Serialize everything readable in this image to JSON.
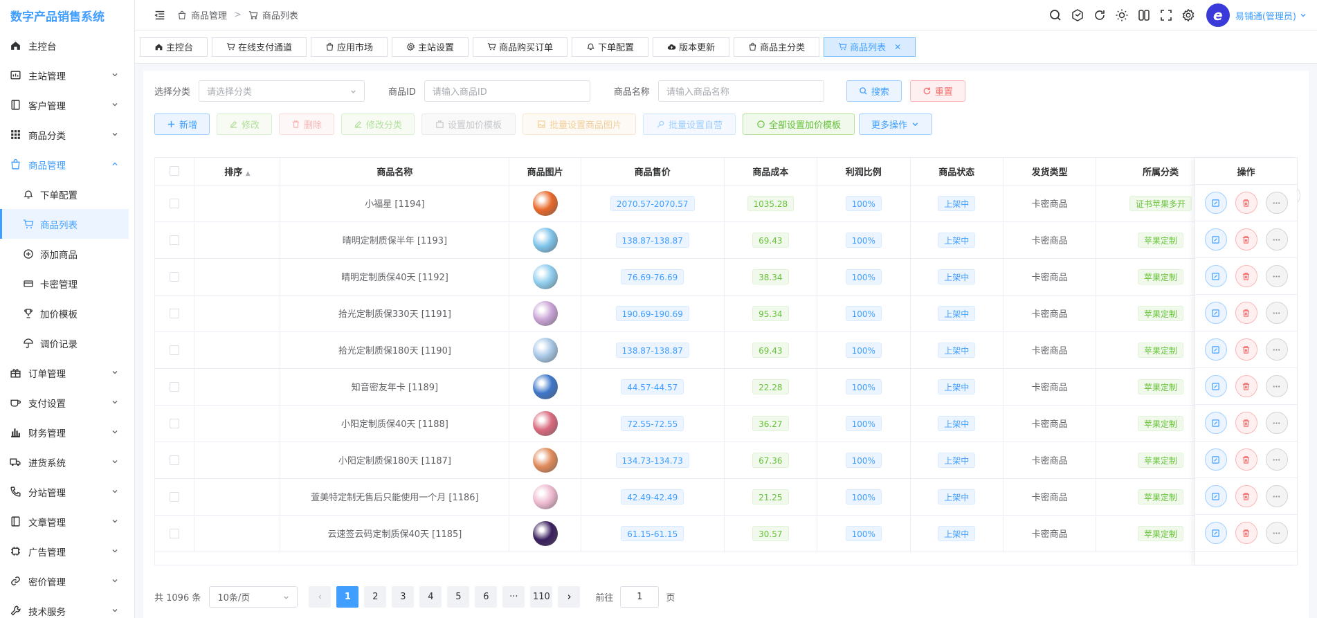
{
  "app": {
    "title": "数字产品销售系统"
  },
  "sidebar": {
    "items": [
      {
        "label": "主控台",
        "icon": "home-icon"
      },
      {
        "label": "主站管理",
        "icon": "dashboard-icon"
      },
      {
        "label": "客户管理",
        "icon": "book-icon"
      },
      {
        "label": "商品分类",
        "icon": "grid-icon"
      },
      {
        "label": "商品管理",
        "icon": "shopping-bag-icon"
      },
      {
        "label": "下单配置",
        "icon": "bell-icon"
      },
      {
        "label": "商品列表",
        "icon": "cart-icon"
      },
      {
        "label": "添加商品",
        "icon": "plus-circle-icon"
      },
      {
        "label": "卡密管理",
        "icon": "credit-card-icon"
      },
      {
        "label": "加价模板",
        "icon": "trophy-icon"
      },
      {
        "label": "调价记录",
        "icon": "umbrella-icon"
      },
      {
        "label": "订单管理",
        "icon": "gift-icon"
      },
      {
        "label": "支付设置",
        "icon": "coffee-icon"
      },
      {
        "label": "财务管理",
        "icon": "bar-chart-icon"
      },
      {
        "label": "进货系统",
        "icon": "truck-icon"
      },
      {
        "label": "分站管理",
        "icon": "phone-icon"
      },
      {
        "label": "文章管理",
        "icon": "book-icon"
      },
      {
        "label": "广告管理",
        "icon": "cpu-icon"
      },
      {
        "label": "密价管理",
        "icon": "link-icon"
      },
      {
        "label": "技术服务",
        "icon": "wrench-icon"
      }
    ]
  },
  "header": {
    "breadcrumb": [
      "商品管理",
      "商品列表"
    ],
    "user": "易铺通(管理员)",
    "avatar_text": "e",
    "avatar_sub": "易铺通"
  },
  "tabs": [
    {
      "label": "主控台"
    },
    {
      "label": "在线支付通道"
    },
    {
      "label": "应用市场"
    },
    {
      "label": "主站设置"
    },
    {
      "label": "商品购买订单"
    },
    {
      "label": "下单配置"
    },
    {
      "label": "版本更新"
    },
    {
      "label": "商品主分类"
    },
    {
      "label": "商品列表"
    }
  ],
  "filters": {
    "category_label": "选择分类",
    "category_placeholder": "请选择分类",
    "id_label": "商品ID",
    "id_placeholder": "请输入商品ID",
    "name_label": "商品名称",
    "name_placeholder": "请输入商品名称",
    "search": "搜索",
    "reset": "重置"
  },
  "toolbar": {
    "add": "新增",
    "edit": "修改",
    "delete": "删除",
    "edit_category": "修改分类",
    "set_template": "设置加价模板",
    "batch_image": "批量设置商品图片",
    "batch_self": "批量设置自营",
    "all_template": "全部设置加价模板",
    "more": "更多操作"
  },
  "table": {
    "columns": [
      "排序",
      "商品名称",
      "商品图片",
      "商品售价",
      "商品成本",
      "利润比例",
      "商品状态",
      "发货类型",
      "所属分类",
      "操作"
    ],
    "rows": [
      {
        "name": "小福星 [1194]",
        "price": "2070.57-2070.57",
        "cost": "1035.28",
        "profit": "100%",
        "status": "上架中",
        "ship": "卡密商品",
        "cat": "证书苹果多开",
        "img": "#e8692a"
      },
      {
        "name": "晴明定制质保半年 [1193]",
        "price": "138.87-138.87",
        "cost": "69.43",
        "profit": "100%",
        "status": "上架中",
        "ship": "卡密商品",
        "cat": "苹果定制",
        "img": "#7fc4ea"
      },
      {
        "name": "晴明定制质保40天 [1192]",
        "price": "76.69-76.69",
        "cost": "38.34",
        "profit": "100%",
        "status": "上架中",
        "ship": "卡密商品",
        "cat": "苹果定制",
        "img": "#8fcdee"
      },
      {
        "name": "拾光定制质保330天 [1191]",
        "price": "190.69-190.69",
        "cost": "95.34",
        "profit": "100%",
        "status": "上架中",
        "ship": "卡密商品",
        "cat": "苹果定制",
        "img": "#c9a4d6"
      },
      {
        "name": "拾光定制质保180天 [1190]",
        "price": "138.87-138.87",
        "cost": "69.43",
        "profit": "100%",
        "status": "上架中",
        "ship": "卡密商品",
        "cat": "苹果定制",
        "img": "#a7c7e6"
      },
      {
        "name": "知音密友年卡 [1189]",
        "price": "44.57-44.57",
        "cost": "22.28",
        "profit": "100%",
        "status": "上架中",
        "ship": "卡密商品",
        "cat": "苹果定制",
        "img": "#3e77c9"
      },
      {
        "name": "小阳定制质保40天 [1188]",
        "price": "72.55-72.55",
        "cost": "36.27",
        "profit": "100%",
        "status": "上架中",
        "ship": "卡密商品",
        "cat": "苹果定制",
        "img": "#d96a7e"
      },
      {
        "name": "小阳定制质保180天 [1187]",
        "price": "134.73-134.73",
        "cost": "67.36",
        "profit": "100%",
        "status": "上架中",
        "ship": "卡密商品",
        "cat": "苹果定制",
        "img": "#e08a5a"
      },
      {
        "name": "萱美特定制无售后只能使用一个月 [1186]",
        "price": "42.49-42.49",
        "cost": "21.25",
        "profit": "100%",
        "status": "上架中",
        "ship": "卡密商品",
        "cat": "苹果定制",
        "img": "#eebad0"
      },
      {
        "name": "云速签云码定制质保40天 [1185]",
        "price": "61.15-61.15",
        "cost": "30.57",
        "profit": "100%",
        "status": "上架中",
        "ship": "卡密商品",
        "cat": "苹果定制",
        "img": "#3a1f5e"
      }
    ]
  },
  "pagination": {
    "total": "共 1096 条",
    "page_size": "10条/页",
    "pages": [
      "1",
      "2",
      "3",
      "4",
      "5",
      "6",
      "···",
      "110"
    ],
    "goto_label": "前往",
    "goto_value": "1",
    "page_suffix": "页"
  }
}
